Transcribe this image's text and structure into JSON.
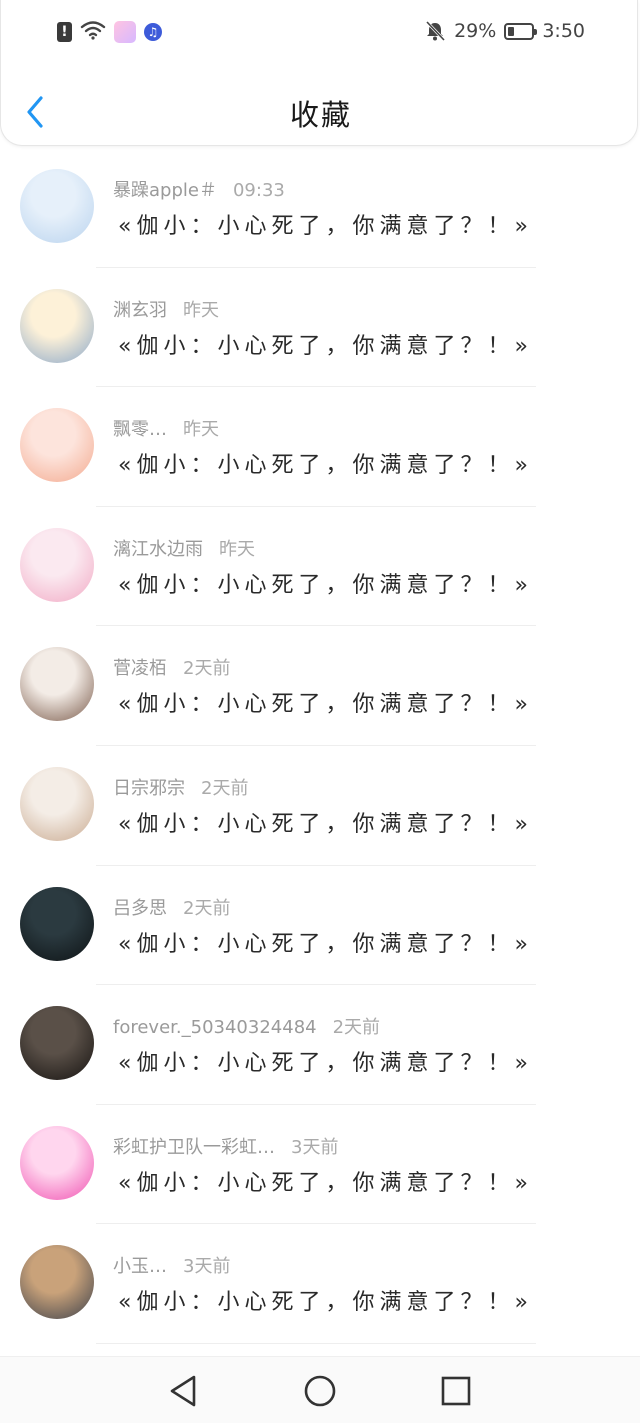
{
  "status_bar": {
    "alert_icon_glyph": "!",
    "battery_percent": "29%",
    "battery_level": 0.29,
    "time": "3:50",
    "icons": [
      "alert-icon",
      "wifi-icon",
      "app-icon",
      "music-icon",
      "bell-off-icon",
      "battery-icon"
    ]
  },
  "header": {
    "title": "收藏",
    "back_icon": "chevron-left-icon",
    "accent_color": "#2196f3"
  },
  "messages": [
    {
      "name": "暴躁apple＃",
      "time": "09:33",
      "text": "«伽小：小心死了，你满意了？！»",
      "avatar_colors": [
        "#e6f0fa",
        "#b9d3ee"
      ]
    },
    {
      "name": "渊玄羽",
      "time": "昨天",
      "text": "«伽小：小心死了，你满意了？！»",
      "avatar_colors": [
        "#fdf1d8",
        "#8aa7c9"
      ]
    },
    {
      "name": "飘零…",
      "time": "昨天",
      "text": "«伽小：小心死了，你满意了？！»",
      "avatar_colors": [
        "#fde4dc",
        "#f3a98e"
      ]
    },
    {
      "name": "漓江水边雨",
      "time": "昨天",
      "text": "«伽小：小心死了，你满意了？！»",
      "avatar_colors": [
        "#fbe9f0",
        "#f1a9c4"
      ]
    },
    {
      "name": "菅凌栢",
      "time": "2天前",
      "text": "«伽小：小心死了，你满意了？！»",
      "avatar_colors": [
        "#f3ece6",
        "#7a5a4a"
      ]
    },
    {
      "name": "日宗邪宗",
      "time": "2天前",
      "text": "«伽小：小心死了，你满意了？！»",
      "avatar_colors": [
        "#f4ede6",
        "#c9a98f"
      ]
    },
    {
      "name": "吕多思",
      "time": "2天前",
      "text": "«伽小：小心死了，你满意了？！»",
      "avatar_colors": [
        "#2b3a40",
        "#0d1214"
      ]
    },
    {
      "name": "forever._50340324484",
      "time": "2天前",
      "text": "«伽小：小心死了，你满意了？！»",
      "avatar_colors": [
        "#5a5048",
        "#151210"
      ]
    },
    {
      "name": "彩虹护卫队一彩虹…",
      "time": "3天前",
      "text": "«伽小：小心死了，你满意了？！»",
      "avatar_colors": [
        "#ffd6ee",
        "#f04fb0"
      ]
    },
    {
      "name": "小玉…",
      "time": "3天前",
      "text": "«伽小：小心死了，你满意了？！»",
      "avatar_colors": [
        "#c9a27a",
        "#3a3f4a"
      ]
    }
  ],
  "bottom_nav": {
    "back": "triangle-back-icon",
    "home": "circle-home-icon",
    "recents": "square-recents-icon"
  }
}
